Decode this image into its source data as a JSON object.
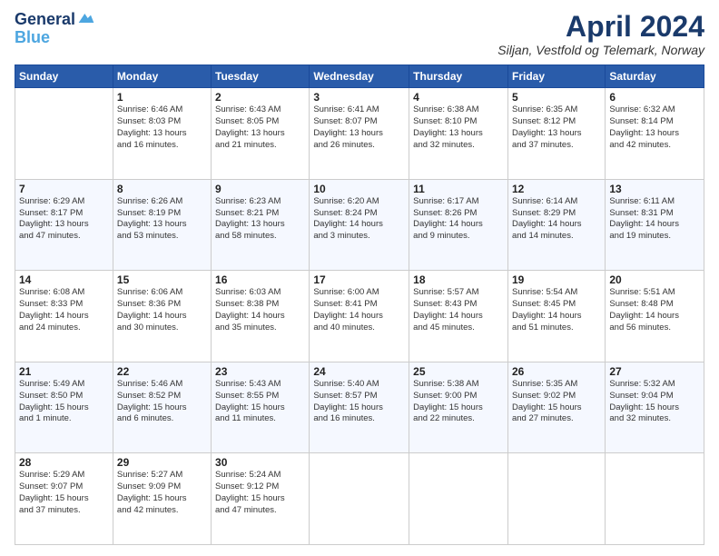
{
  "header": {
    "logo_line1": "General",
    "logo_line2": "Blue",
    "month_title": "April 2024",
    "location": "Siljan, Vestfold og Telemark, Norway"
  },
  "weekdays": [
    "Sunday",
    "Monday",
    "Tuesday",
    "Wednesday",
    "Thursday",
    "Friday",
    "Saturday"
  ],
  "weeks": [
    [
      {
        "day": "",
        "detail": ""
      },
      {
        "day": "1",
        "detail": "Sunrise: 6:46 AM\nSunset: 8:03 PM\nDaylight: 13 hours\nand 16 minutes."
      },
      {
        "day": "2",
        "detail": "Sunrise: 6:43 AM\nSunset: 8:05 PM\nDaylight: 13 hours\nand 21 minutes."
      },
      {
        "day": "3",
        "detail": "Sunrise: 6:41 AM\nSunset: 8:07 PM\nDaylight: 13 hours\nand 26 minutes."
      },
      {
        "day": "4",
        "detail": "Sunrise: 6:38 AM\nSunset: 8:10 PM\nDaylight: 13 hours\nand 32 minutes."
      },
      {
        "day": "5",
        "detail": "Sunrise: 6:35 AM\nSunset: 8:12 PM\nDaylight: 13 hours\nand 37 minutes."
      },
      {
        "day": "6",
        "detail": "Sunrise: 6:32 AM\nSunset: 8:14 PM\nDaylight: 13 hours\nand 42 minutes."
      }
    ],
    [
      {
        "day": "7",
        "detail": "Sunrise: 6:29 AM\nSunset: 8:17 PM\nDaylight: 13 hours\nand 47 minutes."
      },
      {
        "day": "8",
        "detail": "Sunrise: 6:26 AM\nSunset: 8:19 PM\nDaylight: 13 hours\nand 53 minutes."
      },
      {
        "day": "9",
        "detail": "Sunrise: 6:23 AM\nSunset: 8:21 PM\nDaylight: 13 hours\nand 58 minutes."
      },
      {
        "day": "10",
        "detail": "Sunrise: 6:20 AM\nSunset: 8:24 PM\nDaylight: 14 hours\nand 3 minutes."
      },
      {
        "day": "11",
        "detail": "Sunrise: 6:17 AM\nSunset: 8:26 PM\nDaylight: 14 hours\nand 9 minutes."
      },
      {
        "day": "12",
        "detail": "Sunrise: 6:14 AM\nSunset: 8:29 PM\nDaylight: 14 hours\nand 14 minutes."
      },
      {
        "day": "13",
        "detail": "Sunrise: 6:11 AM\nSunset: 8:31 PM\nDaylight: 14 hours\nand 19 minutes."
      }
    ],
    [
      {
        "day": "14",
        "detail": "Sunrise: 6:08 AM\nSunset: 8:33 PM\nDaylight: 14 hours\nand 24 minutes."
      },
      {
        "day": "15",
        "detail": "Sunrise: 6:06 AM\nSunset: 8:36 PM\nDaylight: 14 hours\nand 30 minutes."
      },
      {
        "day": "16",
        "detail": "Sunrise: 6:03 AM\nSunset: 8:38 PM\nDaylight: 14 hours\nand 35 minutes."
      },
      {
        "day": "17",
        "detail": "Sunrise: 6:00 AM\nSunset: 8:41 PM\nDaylight: 14 hours\nand 40 minutes."
      },
      {
        "day": "18",
        "detail": "Sunrise: 5:57 AM\nSunset: 8:43 PM\nDaylight: 14 hours\nand 45 minutes."
      },
      {
        "day": "19",
        "detail": "Sunrise: 5:54 AM\nSunset: 8:45 PM\nDaylight: 14 hours\nand 51 minutes."
      },
      {
        "day": "20",
        "detail": "Sunrise: 5:51 AM\nSunset: 8:48 PM\nDaylight: 14 hours\nand 56 minutes."
      }
    ],
    [
      {
        "day": "21",
        "detail": "Sunrise: 5:49 AM\nSunset: 8:50 PM\nDaylight: 15 hours\nand 1 minute."
      },
      {
        "day": "22",
        "detail": "Sunrise: 5:46 AM\nSunset: 8:52 PM\nDaylight: 15 hours\nand 6 minutes."
      },
      {
        "day": "23",
        "detail": "Sunrise: 5:43 AM\nSunset: 8:55 PM\nDaylight: 15 hours\nand 11 minutes."
      },
      {
        "day": "24",
        "detail": "Sunrise: 5:40 AM\nSunset: 8:57 PM\nDaylight: 15 hours\nand 16 minutes."
      },
      {
        "day": "25",
        "detail": "Sunrise: 5:38 AM\nSunset: 9:00 PM\nDaylight: 15 hours\nand 22 minutes."
      },
      {
        "day": "26",
        "detail": "Sunrise: 5:35 AM\nSunset: 9:02 PM\nDaylight: 15 hours\nand 27 minutes."
      },
      {
        "day": "27",
        "detail": "Sunrise: 5:32 AM\nSunset: 9:04 PM\nDaylight: 15 hours\nand 32 minutes."
      }
    ],
    [
      {
        "day": "28",
        "detail": "Sunrise: 5:29 AM\nSunset: 9:07 PM\nDaylight: 15 hours\nand 37 minutes."
      },
      {
        "day": "29",
        "detail": "Sunrise: 5:27 AM\nSunset: 9:09 PM\nDaylight: 15 hours\nand 42 minutes."
      },
      {
        "day": "30",
        "detail": "Sunrise: 5:24 AM\nSunset: 9:12 PM\nDaylight: 15 hours\nand 47 minutes."
      },
      {
        "day": "",
        "detail": ""
      },
      {
        "day": "",
        "detail": ""
      },
      {
        "day": "",
        "detail": ""
      },
      {
        "day": "",
        "detail": ""
      }
    ]
  ]
}
